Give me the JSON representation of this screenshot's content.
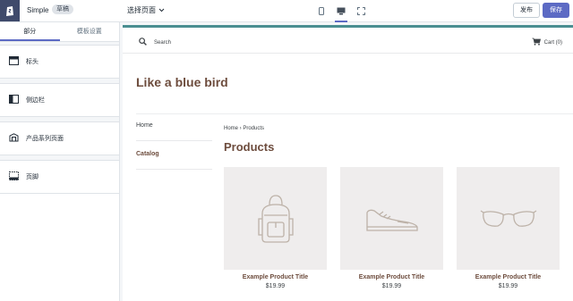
{
  "topbar": {
    "theme_name": "Simple",
    "badge": "草稿",
    "page_select": "选择页面",
    "publish_label": "发布",
    "save_label": "保存",
    "devices": [
      "mobile-icon",
      "desktop-icon",
      "fullscreen-icon"
    ],
    "active_device": "desktop-icon"
  },
  "sidebar": {
    "tabs": [
      {
        "label": "部分",
        "active": true
      },
      {
        "label": "模板设置",
        "active": false
      }
    ],
    "sections": [
      {
        "label": "标头",
        "icon": "header-icon"
      },
      {
        "label": "侧边栏",
        "icon": "sidebar-icon"
      },
      {
        "label": "产品系列页面",
        "icon": "collection-icon"
      },
      {
        "label": "页脚",
        "icon": "footer-icon"
      }
    ]
  },
  "preview": {
    "search_label": "Search",
    "cart_label": "Cart (0)",
    "store_title": "Like a blue bird",
    "nav": [
      "Home",
      "Catalog"
    ],
    "breadcrumb": "Home › Products",
    "page_title": "Products",
    "products": [
      {
        "title": "Example Product Title",
        "price": "$19.99",
        "icon": "backpack-icon"
      },
      {
        "title": "Example Product Title",
        "price": "$19.99",
        "icon": "shoe-icon"
      },
      {
        "title": "Example Product Title",
        "price": "$19.99",
        "icon": "glasses-icon"
      }
    ]
  },
  "colors": {
    "accent": "#5c6ac4",
    "brand_text": "#6d4c3d",
    "preview_top_border": "#4a8e91",
    "product_bg": "#efeded"
  }
}
